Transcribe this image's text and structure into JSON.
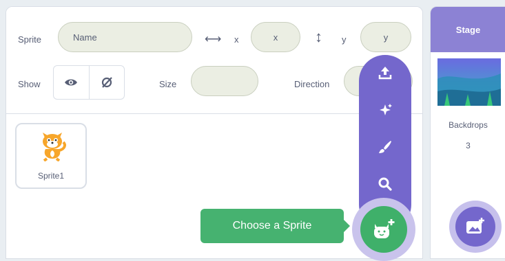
{
  "sprite_info": {
    "sprite_label": "Sprite",
    "name_placeholder": "Name",
    "x_label": "x",
    "x_placeholder": "x",
    "y_label": "y",
    "y_placeholder": "y",
    "show_label": "Show",
    "size_label": "Size",
    "size_value": "",
    "direction_label": "Direction",
    "direction_value": ""
  },
  "sprites": [
    {
      "name": "Sprite1",
      "selected": true
    }
  ],
  "sprite_menu": {
    "items": [
      "upload-sprite",
      "surprise",
      "paint",
      "choose-search"
    ],
    "tooltip": "Choose a Sprite"
  },
  "stage": {
    "title": "Stage",
    "backdrops_label": "Backdrops",
    "backdrops_count": "3"
  },
  "colors": {
    "menu_purple": "#7467cc",
    "accent_green": "#46b270",
    "stage_header": "#8c82d4",
    "pill_bg": "#ebeee3"
  }
}
